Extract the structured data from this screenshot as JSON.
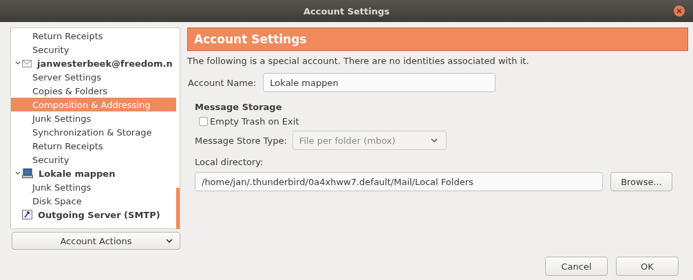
{
  "window": {
    "title": "Account Settings"
  },
  "tree": [
    {
      "kind": "page",
      "label": "Return Receipts",
      "selected": false
    },
    {
      "kind": "page",
      "label": "Security",
      "selected": false
    },
    {
      "kind": "mail-account",
      "label": "janwesterbeek@freedom.n",
      "expanded": true,
      "selected": false,
      "children": [
        {
          "kind": "page",
          "label": "Server Settings",
          "selected": false
        },
        {
          "kind": "page",
          "label": "Copies & Folders",
          "selected": false
        },
        {
          "kind": "page",
          "label": "Composition & Addressing",
          "selected": true
        },
        {
          "kind": "page",
          "label": "Junk Settings",
          "selected": false
        },
        {
          "kind": "page",
          "label": "Synchronization & Storage",
          "selected": false
        },
        {
          "kind": "page",
          "label": "Return Receipts",
          "selected": false
        },
        {
          "kind": "page",
          "label": "Security",
          "selected": false
        }
      ]
    },
    {
      "kind": "local-account",
      "label": "Lokale mappen",
      "expanded": true,
      "selected": false,
      "children": [
        {
          "kind": "page",
          "label": "Junk Settings",
          "selected": false
        },
        {
          "kind": "page",
          "label": "Disk Space",
          "selected": false
        }
      ]
    },
    {
      "kind": "smtp-server",
      "label": "Outgoing Server (SMTP)",
      "selected": false
    }
  ],
  "account_actions": "Account Actions",
  "header": "Account Settings",
  "intro": "The following is a special account. There are no identities associated with it.",
  "account_name": {
    "label": "Account Name:",
    "value": "Lokale mappen"
  },
  "storage": {
    "heading": "Message Storage",
    "empty_trash": {
      "label": "Empty Trash on Exit",
      "checked": false
    },
    "store_type": {
      "label": "Message Store Type:",
      "value": "File per folder (mbox)",
      "disabled": true
    },
    "local_directory": {
      "label": "Local directory:",
      "value": "/home/jan/.thunderbird/0a4xhww7.default/Mail/Local Folders"
    },
    "browse": "Browse..."
  },
  "buttons": [
    {
      "label": "Cancel"
    },
    {
      "label": "OK"
    }
  ]
}
